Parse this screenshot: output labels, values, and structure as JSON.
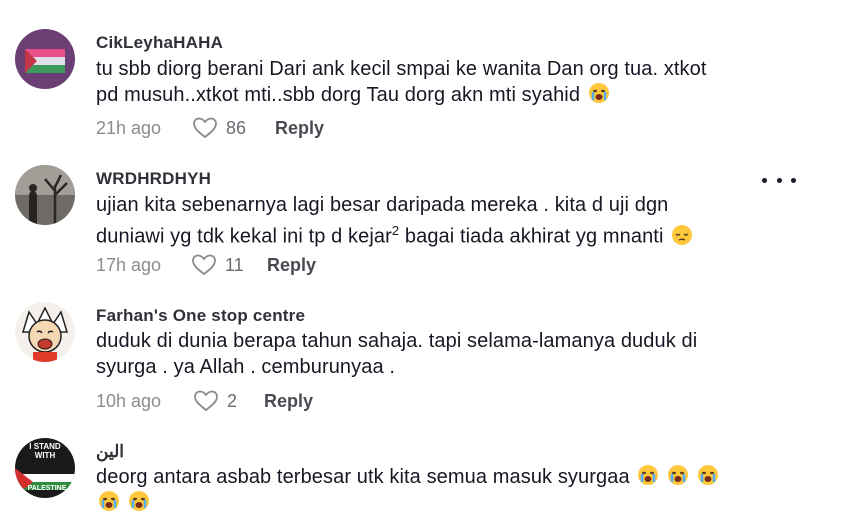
{
  "comments": [
    {
      "username": "CikLeyhaHAHA",
      "text_line1": "tu sbb diorg berani Dari ank kecil smpai ke wanita Dan org tua. xtkot",
      "text_line2": "pd musuh..xtkot mti..sbb dorg Tau dorg akn mti syahid",
      "emoji": "crying-face",
      "time": "21h ago",
      "likes": "86",
      "reply": "Reply"
    },
    {
      "username": "WRDHRDHYH",
      "text_line1": "ujian kita sebenarnya lagi besar daripada mereka . kita d uji dgn",
      "text_line2_a": "duniawi yg tdk kekal ini tp d kejar",
      "superscript": "2",
      "text_line2_b": " bagai tiada akhirat yg mnanti",
      "emoji": "pensive-face",
      "time": "17h ago",
      "likes": "11",
      "reply": "Reply"
    },
    {
      "username": "Farhan's One stop centre",
      "text_line1": "duduk di dunia berapa tahun sahaja. tapi selama-lamanya duduk di",
      "text_line2": "syurga . ya Allah . cemburunyaa .",
      "time": "10h ago",
      "likes": "2",
      "reply": "Reply"
    },
    {
      "username": "الين",
      "text_line1": "deorg antara asbab terbesar utk kita semua masuk syurgaa",
      "emoji": "crying-face",
      "avatar_text_1": "I STAND",
      "avatar_text_2": "WITH",
      "avatar_text_3": "PALESTINE"
    }
  ],
  "more_icon": "more-horizontal-icon",
  "like_icon": "heart-outline-icon",
  "colors": {
    "text": "#161823",
    "muted": "#8a8b91",
    "username": "#2f3038"
  }
}
